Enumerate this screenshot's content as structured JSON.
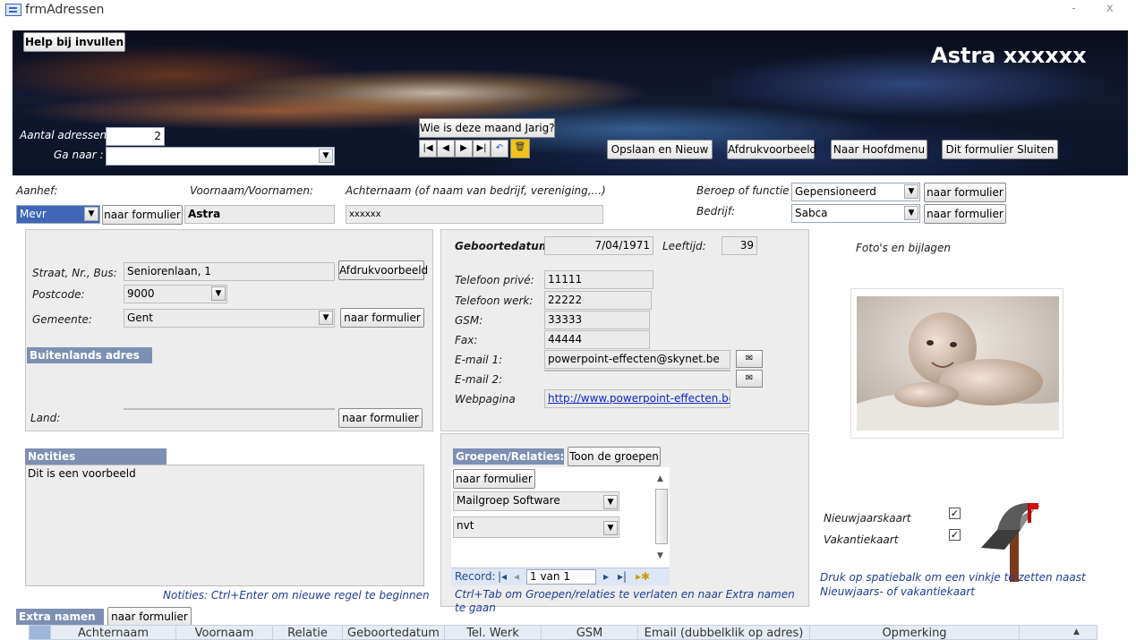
{
  "window": {
    "title": "frmAdressen",
    "min": "-",
    "close": "x"
  },
  "banner": {
    "help_button": "Help bij invullen",
    "app_title": "Astra xxxxxx",
    "count_label": "Aantal adressen:",
    "count_value": "2",
    "goto_label": "Ga naar :",
    "goto_value": "",
    "birthday_button": "Wie is deze maand Jarig?",
    "save_new_button": "Opslaan en Nieuw",
    "print_preview_button": "Afdrukvoorbeeld",
    "main_menu_button": "Naar Hoofdmenu",
    "close_form_button": "Dit formulier Sluiten"
  },
  "fields": {
    "aanhef_label": "Aanhef:",
    "aanhef_value": "Mevr",
    "naar_formulier": "naar formulier",
    "voornaam_label": "Voornaam/Voornamen:",
    "voornaam_value": "Astra",
    "achternaam_label": "Achternaam (of naam van bedrijf, vereniging,...)",
    "achternaam_value": "xxxxxx",
    "beroep_label": "Beroep of functie",
    "beroep_value": "Gepensioneerd",
    "bedrijf_label": "Bedrijf:",
    "bedrijf_value": "Sabca"
  },
  "address": {
    "straat_label": "Straat, Nr., Bus:",
    "straat_value": "Seniorenlaan, 1",
    "afdruk_button": "Afdrukvoorbeeld",
    "postcode_label": "Postcode:",
    "postcode_value": "9000",
    "gemeente_label": "Gemeente:",
    "gemeente_value": "Gent",
    "buitenlands_header": "Buitenlands adres",
    "land_label": "Land:",
    "land_value": ""
  },
  "contact": {
    "geboortedatum_label": "Geboortedatum",
    "geboortedatum_value": "7/04/1971",
    "leeftijd_label": "Leeftijd:",
    "leeftijd_value": "39",
    "tel_prive_label": "Telefoon privé:",
    "tel_prive_value": "11111",
    "tel_werk_label": "Telefoon werk:",
    "tel_werk_value": "22222",
    "gsm_label": "GSM:",
    "gsm_value": "33333",
    "fax_label": "Fax:",
    "fax_value": "44444",
    "email1_label": "E-mail 1:",
    "email1_value": "powerpoint-effecten@skynet.be",
    "email2_label": "E-mail 2:",
    "email2_value": "",
    "web_label": "Webpagina",
    "web_value": "http://www.powerpoint-effecten.be"
  },
  "photo": {
    "label": "Foto's en bijlagen"
  },
  "notes": {
    "header": "Notities",
    "text": "Dit is een voorbeeld",
    "hint": "Notities: Ctrl+Enter om nieuwe regel te beginnen"
  },
  "groups": {
    "header": "Groepen/Relaties:",
    "show_button": "Toon de groepen",
    "form_button": "naar formulier",
    "row1": "Mailgroep Software",
    "row2": "nvt",
    "record_label": "Record:",
    "record_value": "1 van 1",
    "hint": "Ctrl+Tab om Groepen/relaties te verlaten en naar Extra namen te gaan"
  },
  "cards": {
    "nieuwjaar_label": "Nieuwjaarskaart",
    "vakantie_label": "Vakantiekaart",
    "nieuwjaar_checked": true,
    "vakantie_checked": true,
    "hint": "Druk op spatiebalk om een vinkje te zetten naast Nieuwjaars- of vakantiekaart"
  },
  "extra": {
    "header": "Extra namen",
    "form_button": "naar formulier",
    "columns": [
      "Achternaam",
      "Voornaam",
      "Relatie",
      "Geboortedatum",
      "Tel. Werk",
      "GSM",
      "Email (dubbelklik op adres)",
      "Opmerking"
    ]
  }
}
